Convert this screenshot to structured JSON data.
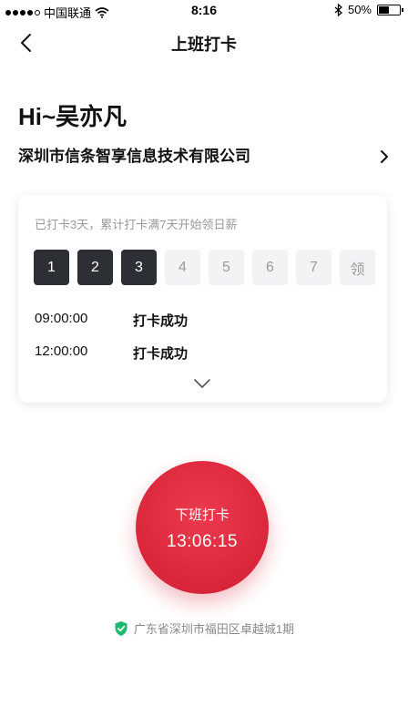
{
  "status_bar": {
    "carrier": "中国联通",
    "time": "8:16",
    "battery": "50%",
    "battery_level": 0.5,
    "signal_bars": 4
  },
  "nav": {
    "title": "上班打卡"
  },
  "greeting": "Hi~吴亦凡",
  "company": {
    "name": "深圳市信条智享信息技术有限公司"
  },
  "card": {
    "note": "已打卡3天，累计打卡满7天开始领日薪",
    "days": [
      {
        "label": "1",
        "done": true
      },
      {
        "label": "2",
        "done": true
      },
      {
        "label": "3",
        "done": true
      },
      {
        "label": "4",
        "done": false
      },
      {
        "label": "5",
        "done": false
      },
      {
        "label": "6",
        "done": false
      },
      {
        "label": "7",
        "done": false
      },
      {
        "label": "领",
        "done": false
      }
    ],
    "records": [
      {
        "time": "09:00:00",
        "status": "打卡成功"
      },
      {
        "time": "12:00:00",
        "status": "打卡成功"
      }
    ]
  },
  "punch": {
    "label": "下班打卡",
    "time": "13:06:15"
  },
  "location": "广东省深圳市福田区卓越城1期",
  "colors": {
    "accent": "#d9263b",
    "day_done": "#2e2f34",
    "day_todo": "#f3f3f5",
    "location_ok": "#1fb86e"
  }
}
